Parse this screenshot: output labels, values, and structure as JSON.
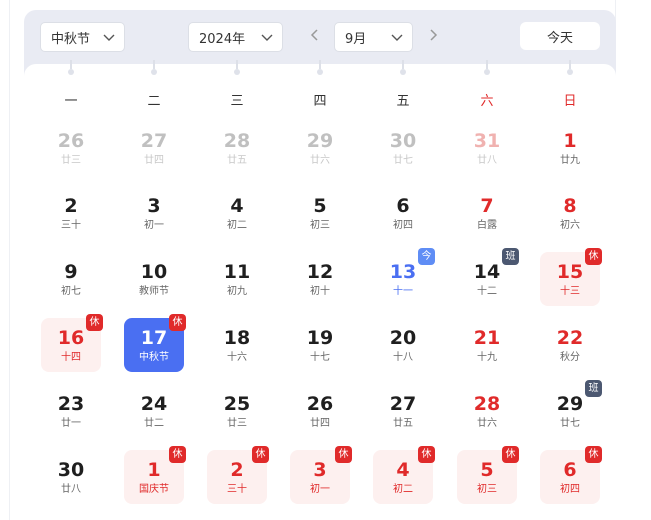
{
  "header": {
    "festival_select": "中秋节",
    "year_select": "2024年",
    "month_select": "9月",
    "today_button": "今天",
    "prev_icon": "chevron-left-icon",
    "next_icon": "chevron-right-icon"
  },
  "weekdays": [
    "一",
    "二",
    "三",
    "四",
    "五",
    "六",
    "日"
  ],
  "colors": {
    "accent": "#4a6ff2",
    "holiday_red": "#e02a2a",
    "holiday_bg": "#fdf0ef",
    "workday_badge": "#4c5871",
    "today_badge": "#5f8df5"
  },
  "weeks": [
    [
      {
        "num": "26",
        "sub": "廿三",
        "style": "dim"
      },
      {
        "num": "27",
        "sub": "廿四",
        "style": "dim"
      },
      {
        "num": "28",
        "sub": "廿五",
        "style": "dim"
      },
      {
        "num": "29",
        "sub": "廿六",
        "style": "dim"
      },
      {
        "num": "30",
        "sub": "廿七",
        "style": "dim"
      },
      {
        "num": "31",
        "sub": "廿八",
        "style": "dimred"
      },
      {
        "num": "1",
        "sub": "廿九",
        "style": "redweek"
      }
    ],
    [
      {
        "num": "2",
        "sub": "三十",
        "style": ""
      },
      {
        "num": "3",
        "sub": "初一",
        "style": ""
      },
      {
        "num": "4",
        "sub": "初二",
        "style": ""
      },
      {
        "num": "5",
        "sub": "初三",
        "style": ""
      },
      {
        "num": "6",
        "sub": "初四",
        "style": ""
      },
      {
        "num": "7",
        "sub": "白露",
        "style": "redweek"
      },
      {
        "num": "8",
        "sub": "初六",
        "style": "redweek"
      }
    ],
    [
      {
        "num": "9",
        "sub": "初七",
        "style": ""
      },
      {
        "num": "10",
        "sub": "教师节",
        "style": ""
      },
      {
        "num": "11",
        "sub": "初九",
        "style": ""
      },
      {
        "num": "12",
        "sub": "初十",
        "style": ""
      },
      {
        "num": "13",
        "sub": "十一",
        "style": "today",
        "badge": "今",
        "badge_type": "now"
      },
      {
        "num": "14",
        "sub": "十二",
        "style": "",
        "badge": "班",
        "badge_type": "work"
      },
      {
        "num": "15",
        "sub": "十三",
        "style": "red holiday",
        "badge": "休",
        "badge_type": "rest"
      }
    ],
    [
      {
        "num": "16",
        "sub": "十四",
        "style": "red holiday",
        "badge": "休",
        "badge_type": "rest"
      },
      {
        "num": "17",
        "sub": "中秋节",
        "style": "selected",
        "badge": "休",
        "badge_type": "rest"
      },
      {
        "num": "18",
        "sub": "十六",
        "style": ""
      },
      {
        "num": "19",
        "sub": "十七",
        "style": ""
      },
      {
        "num": "20",
        "sub": "十八",
        "style": ""
      },
      {
        "num": "21",
        "sub": "十九",
        "style": "redweek"
      },
      {
        "num": "22",
        "sub": "秋分",
        "style": "redweek"
      }
    ],
    [
      {
        "num": "23",
        "sub": "廿一",
        "style": ""
      },
      {
        "num": "24",
        "sub": "廿二",
        "style": ""
      },
      {
        "num": "25",
        "sub": "廿三",
        "style": ""
      },
      {
        "num": "26",
        "sub": "廿四",
        "style": ""
      },
      {
        "num": "27",
        "sub": "廿五",
        "style": ""
      },
      {
        "num": "28",
        "sub": "廿六",
        "style": "redweek"
      },
      {
        "num": "29",
        "sub": "廿七",
        "style": "",
        "badge": "班",
        "badge_type": "work"
      }
    ],
    [
      {
        "num": "30",
        "sub": "廿八",
        "style": ""
      },
      {
        "num": "1",
        "sub": "国庆节",
        "style": "red holiday",
        "badge": "休",
        "badge_type": "rest"
      },
      {
        "num": "2",
        "sub": "三十",
        "style": "red holiday",
        "badge": "休",
        "badge_type": "rest"
      },
      {
        "num": "3",
        "sub": "初一",
        "style": "red holiday",
        "badge": "休",
        "badge_type": "rest"
      },
      {
        "num": "4",
        "sub": "初二",
        "style": "red holiday",
        "badge": "休",
        "badge_type": "rest"
      },
      {
        "num": "5",
        "sub": "初三",
        "style": "red holiday",
        "badge": "休",
        "badge_type": "rest"
      },
      {
        "num": "6",
        "sub": "初四",
        "style": "red holiday",
        "badge": "休",
        "badge_type": "rest"
      }
    ]
  ]
}
